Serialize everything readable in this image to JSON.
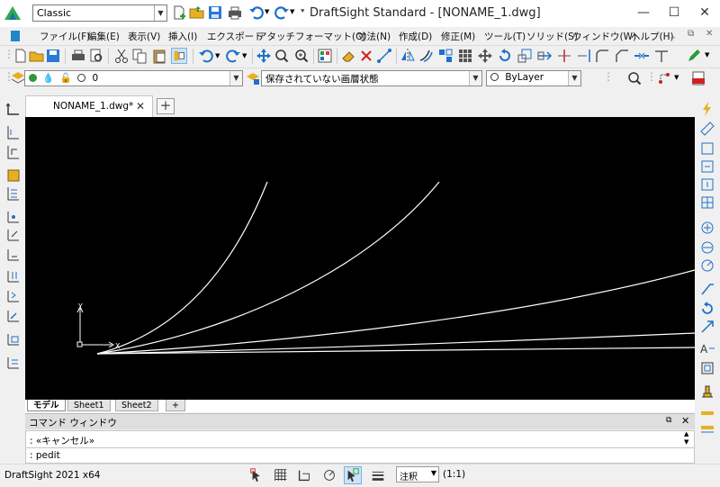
{
  "titlebar": {
    "workspace": "Classic",
    "window_title": "DraftSight Standard - [NONAME_1.dwg]"
  },
  "menu": {
    "items": [
      "ファイル(F)",
      "編集(E)",
      "表示(V)",
      "挿入(I)",
      "エクスポート",
      "アタッチ",
      "フォーマット(O)",
      "寸法(N)",
      "作成(D)",
      "修正(M)",
      "ツール(T)",
      "ソリッド(S)",
      "ウィンドウ(W)",
      "ヘルプ(H)"
    ]
  },
  "layer_bar": {
    "layer_name": "0",
    "layer_state": "保存されていない画層状態",
    "line_color": "ByLayer"
  },
  "document": {
    "tab_label": "NONAME_1.dwg*"
  },
  "canvas": {
    "background": "#000000",
    "stroke": "#ffffff",
    "ucs_x_label": "X",
    "ucs_y_label": "Y"
  },
  "layout_tabs": [
    "モデル",
    "Sheet1",
    "Sheet2"
  ],
  "command_window": {
    "title": "コマンド ウィンドウ",
    "history_line": ": «キャンセル»",
    "input_line": ": pedit"
  },
  "statusbar": {
    "version": "DraftSight 2021 x64",
    "annotation": "注釈",
    "scale": "(1:1)"
  },
  "colors": {
    "accent": "#1e88c8",
    "save_icon": "#2a7ad4",
    "folder_icon": "#e8b020",
    "grid_bg": "#000000"
  }
}
